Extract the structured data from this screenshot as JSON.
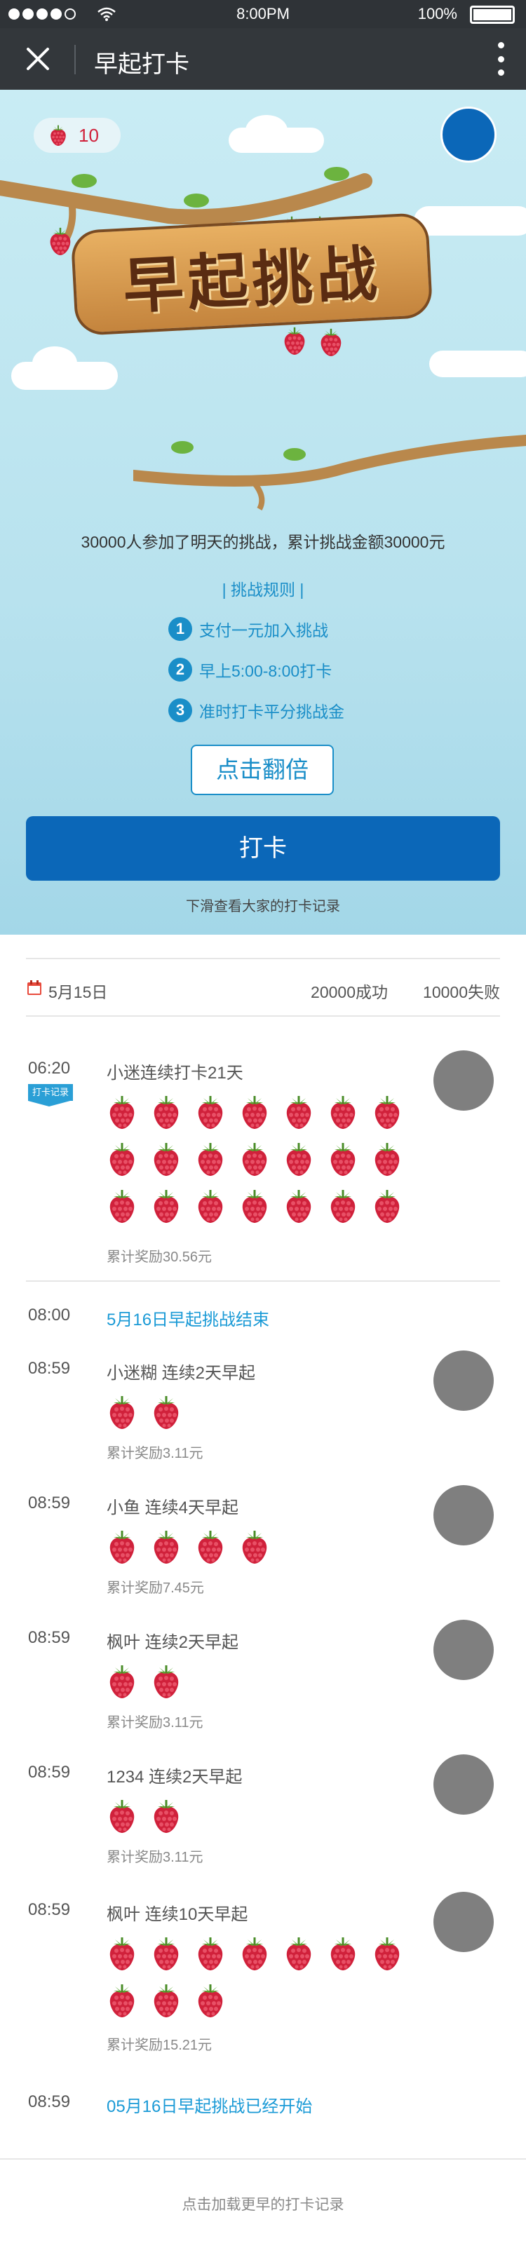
{
  "status_bar": {
    "time": "8:00PM",
    "battery": "100%",
    "battery_level": 1.0
  },
  "nav": {
    "title": "早起打卡"
  },
  "hero": {
    "berry_count": "10",
    "sign_text": "早起挑战",
    "participants": "30000人参加了明天的挑战，累计挑战金额30000元",
    "rules_title": "|  挑战规则  |",
    "rules": [
      {
        "num": "1",
        "text": "支付一元加入挑战"
      },
      {
        "num": "2",
        "text": "早上5:00-8:00打卡"
      },
      {
        "num": "3",
        "text": "准时打卡平分挑战金"
      }
    ],
    "double_label": "点击翻倍",
    "checkin_label": "打卡",
    "scroll_hint": "下滑查看大家的打卡记录"
  },
  "summary": {
    "date": "5月15日",
    "success": "20000成功",
    "fail": "10000失败"
  },
  "records": [
    {
      "time": "06:20",
      "tag": "打卡记录",
      "name": "小迷连续打卡21天",
      "berries": 21,
      "reward": "累计奖励30.56元"
    },
    {
      "time": "08:59",
      "name": "小迷糊 连续2天早起",
      "berries": 2,
      "reward": "累计奖励3.11元"
    },
    {
      "time": "08:59",
      "name": "小鱼 连续4天早起",
      "berries": 4,
      "reward": "累计奖励7.45元"
    },
    {
      "time": "08:59",
      "name": "枫叶 连续2天早起",
      "berries": 2,
      "reward": "累计奖励3.11元"
    },
    {
      "time": "08:59",
      "name": "1234 连续2天早起",
      "berries": 2,
      "reward": "累计奖励3.11元"
    },
    {
      "time": "08:59",
      "name": "枫叶 连续10天早起",
      "berries": 10,
      "reward": "累计奖励15.21元"
    }
  ],
  "notices": [
    {
      "time": "08:00",
      "text": "5月16日早起挑战结束"
    },
    {
      "time": "08:59",
      "text": "05月16日早起挑战已经开始"
    }
  ],
  "load_more": "点击加载更早的打卡记录",
  "colors": {
    "primary": "#0b67b8",
    "accent": "#1a8ec8",
    "berry": "#d0213b"
  }
}
